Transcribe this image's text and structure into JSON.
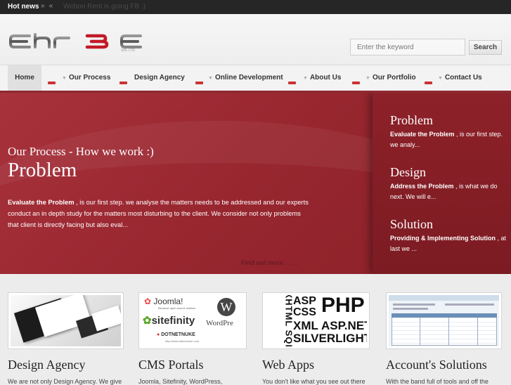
{
  "newsbar": {
    "label": "Hot news",
    "prev_icon": "»",
    "next_icon": "«",
    "item": "Webon Rent is going FB :)"
  },
  "header": {
    "logo_sub": "SRL LTD",
    "search": {
      "placeholder": "Enter the keyword",
      "button": "Search"
    }
  },
  "nav": {
    "items": [
      {
        "label": "Home"
      },
      {
        "label": "Our Process"
      },
      {
        "label": "Design Agency"
      },
      {
        "label": "Online Development"
      },
      {
        "label": "About Us"
      },
      {
        "label": "Our Portfolio"
      },
      {
        "label": "Contact Us"
      }
    ]
  },
  "hero": {
    "kicker": "Our Process - How we work :)",
    "title": "Problem",
    "text_bold": "Evaluate the Problem",
    "text": " , is our first step. we analyse the matters needs to be addressed and our experts conduct an in depth study for the matters most disturbing to the client. We consider not only problems that client is directly facing but also eval...",
    "find_more": "Find out more . . . .",
    "side": [
      {
        "title": "Problem",
        "bold": "Evaluate the Problem",
        "text": " , is our first step. we analy..."
      },
      {
        "title": "Design",
        "bold": "Address the Problem",
        "text": " , is what we do next. We will e..."
      },
      {
        "title": "Solution",
        "bold": "Providing & Implementing Solution",
        "text": " , at last we ..."
      }
    ]
  },
  "cards": [
    {
      "title": "Design Agency",
      "text": "We are not only Design Agency. We give"
    },
    {
      "title": "CMS Portals",
      "text": "Joomla, Sitefinity, WordPress,"
    },
    {
      "title": "Web Apps",
      "text": "You don't like what you see out there"
    },
    {
      "title": "Account's Solutions",
      "text": "With the band full of tools and off the"
    }
  ],
  "thumb_text": {
    "joomla": "Joomla!",
    "joomla_sub": "Because open source matters",
    "sitefinity": "sitefinity",
    "wordpress": "WordPre",
    "dnn": "DOTNETNUKE",
    "dnn_sub": "http://www.dotnetnuke.com",
    "tech_left": "XHTML SQL",
    "tech1": "ASP",
    "tech2": "CSS",
    "tech3": "PHP",
    "tech4": "XML",
    "tech5": "ASP.NET",
    "tech6": "SILVERLIGHT"
  },
  "colors": {
    "accent": "#97262f",
    "nav_border": "#8c2a30",
    "newsbar": "#262626"
  }
}
